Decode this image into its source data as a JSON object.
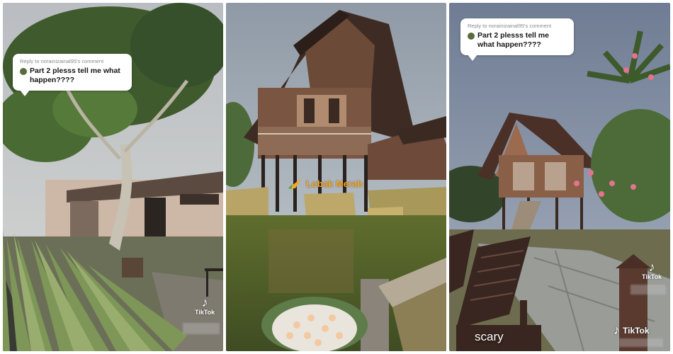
{
  "panels": [
    {
      "comment": {
        "reply_to": "Reply to norainizainal95's comment",
        "text": "Part 2 plesss tell me what happen????"
      },
      "badge": {
        "icon": "tiktok-note-icon",
        "label": "TikTok"
      }
    },
    {
      "watermark": {
        "text": "Lobak Merah",
        "color": "#f5a623"
      }
    },
    {
      "comment": {
        "reply_to": "Reply to norainizainal95's comment",
        "text": "Part 2 plesss tell me what happen????"
      },
      "badge": {
        "icon": "tiktok-note-icon",
        "label": "TikTok"
      },
      "badge_bottom": {
        "icon": "tiktok-note-icon",
        "label": "TikTok"
      },
      "caption": "scary"
    }
  ]
}
